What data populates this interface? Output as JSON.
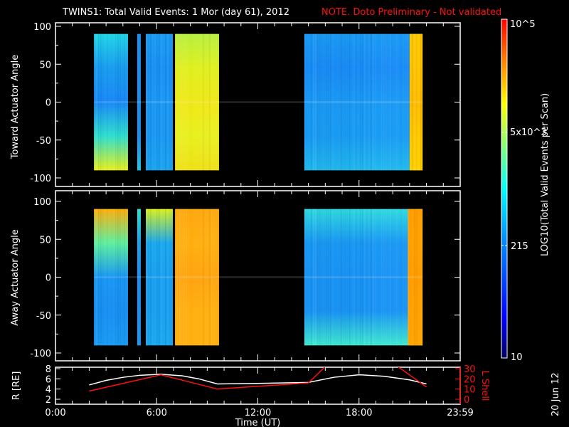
{
  "title": "TWINS1: Total Valid Events:  1 Mor (day  61), 2012",
  "note": "NOTE. Doto Preliminary - Not validated",
  "side_date": "20 Jun 12",
  "colors": {
    "note": "#ff1010",
    "r_line": "#ffffff",
    "l_line": "#ff1010"
  },
  "chart_data": [
    {
      "type": "heatmap",
      "name": "toward-panel",
      "ylabel": "Toward Actuator Angle",
      "ylim": [
        -100,
        100
      ],
      "yticks": [
        "100",
        "50",
        "0",
        "-50",
        "-100"
      ],
      "ytick_values": [
        100,
        50,
        0,
        -50,
        -100
      ],
      "xlim_hours": [
        0,
        24
      ],
      "blocks": [
        {
          "start": 2.28,
          "end": 4.3,
          "colors": [
            "#22d6e8",
            "#1a9cf0",
            "#1a8af8",
            "#30e0d0",
            "#e8f020"
          ]
        },
        {
          "start": 4.85,
          "end": 5.06,
          "colors": [
            "#1a90f4",
            "#1a90f4",
            "#1a90f4",
            "#1a90f4",
            "#22c8e8"
          ]
        },
        {
          "start": 5.36,
          "end": 6.96,
          "colors": [
            "#1a9cf4",
            "#1a90f4",
            "#1a98f4",
            "#1a98f4",
            "#1aa4f0"
          ]
        },
        {
          "start": 7.09,
          "end": 9.7,
          "colors": [
            "#b8f040",
            "#e0f020",
            "#f0e818",
            "#e8f020",
            "#f0e018"
          ]
        },
        {
          "start": 14.76,
          "end": 21.77,
          "colors": [
            "#1a9af4",
            "#1a8cf6",
            "#1a9af4",
            "#1a9cf4",
            "#22b8ec"
          ]
        },
        {
          "start": 21.0,
          "end": 21.77,
          "colors": [
            "#ffc800",
            "#ffc400",
            "#ffbc00",
            "#ffc800",
            "#ffd000"
          ]
        }
      ]
    },
    {
      "type": "heatmap",
      "name": "away-panel",
      "ylabel": "Away Actuator Angle",
      "ylim": [
        -100,
        100
      ],
      "yticks": [
        "100",
        "50",
        "0",
        "-50",
        "-100"
      ],
      "ytick_values": [
        100,
        50,
        0,
        -50,
        -100
      ],
      "xlim_hours": [
        0,
        24
      ],
      "blocks": [
        {
          "start": 2.28,
          "end": 4.3,
          "colors": [
            "#ffb010",
            "#60f0a0",
            "#1a98f4",
            "#1a90f4",
            "#1a9cf4"
          ]
        },
        {
          "start": 4.85,
          "end": 5.06,
          "colors": [
            "#30e0d0",
            "#1aa4f0",
            "#1a90f4",
            "#1a90f4",
            "#1a98f4"
          ]
        },
        {
          "start": 5.36,
          "end": 6.96,
          "colors": [
            "#d8f020",
            "#1aa8f0",
            "#1aa0f0",
            "#1aa0f0",
            "#1aa8f0"
          ]
        },
        {
          "start": 7.09,
          "end": 9.7,
          "colors": [
            "#ffa810",
            "#ffb010",
            "#ffa410",
            "#ffb010",
            "#ffb010"
          ]
        },
        {
          "start": 14.76,
          "end": 21.77,
          "colors": [
            "#30d8e0",
            "#1a98f4",
            "#1a94f4",
            "#1a94f4",
            "#40e8d0"
          ]
        },
        {
          "start": 20.9,
          "end": 21.77,
          "colors": [
            "#ff9c00",
            "#ffa000",
            "#ff9c00",
            "#ffa000",
            "#ffa400"
          ]
        }
      ]
    },
    {
      "type": "line",
      "name": "orbit-panel",
      "xlabel": "Time (UT)",
      "xticks": [
        "0:00",
        "6:00",
        "12:00",
        "18:00",
        "23:59"
      ],
      "xtick_values": [
        0,
        6,
        12,
        18,
        24
      ],
      "ylabel": "R [RE]",
      "ylim": [
        2,
        8
      ],
      "yticks": [
        "8",
        "6",
        "4",
        "2"
      ],
      "ytick_values": [
        8,
        6,
        4,
        2
      ],
      "y2label": "L Shell",
      "y2lim": [
        0,
        30
      ],
      "y2ticks": [
        "30",
        "20",
        "10",
        "0"
      ],
      "y2tick_values": [
        30,
        20,
        10,
        0
      ],
      "series": [
        {
          "name": "R",
          "axis": "left",
          "x": [
            2.0,
            3.0,
            4.0,
            5.0,
            6.25,
            7.5,
            8.5,
            9.6,
            12.0,
            15.0,
            16.5,
            18.0,
            19.5,
            21.0,
            22.0
          ],
          "y": [
            4.8,
            5.7,
            6.3,
            6.7,
            6.9,
            6.6,
            6.0,
            5.0,
            5.1,
            5.3,
            6.3,
            6.8,
            6.5,
            5.8,
            5.0
          ]
        },
        {
          "name": "L Shell",
          "axis": "right",
          "x": [
            2.0,
            6.25,
            9.6,
            15.0,
            16.0,
            20.3,
            22.0
          ],
          "y": [
            8,
            24,
            10,
            16,
            32,
            32,
            12
          ]
        }
      ]
    }
  ],
  "colorbar": {
    "label": "LOG10(Total Valid Events per Scan)",
    "ticks": [
      {
        "label": "10^5",
        "value": 100000
      },
      {
        "label": "5x10^3",
        "value": 5000
      },
      {
        "label": "215",
        "value": 215
      },
      {
        "label": "10",
        "value": 10
      }
    ],
    "range": [
      10,
      100000
    ]
  }
}
